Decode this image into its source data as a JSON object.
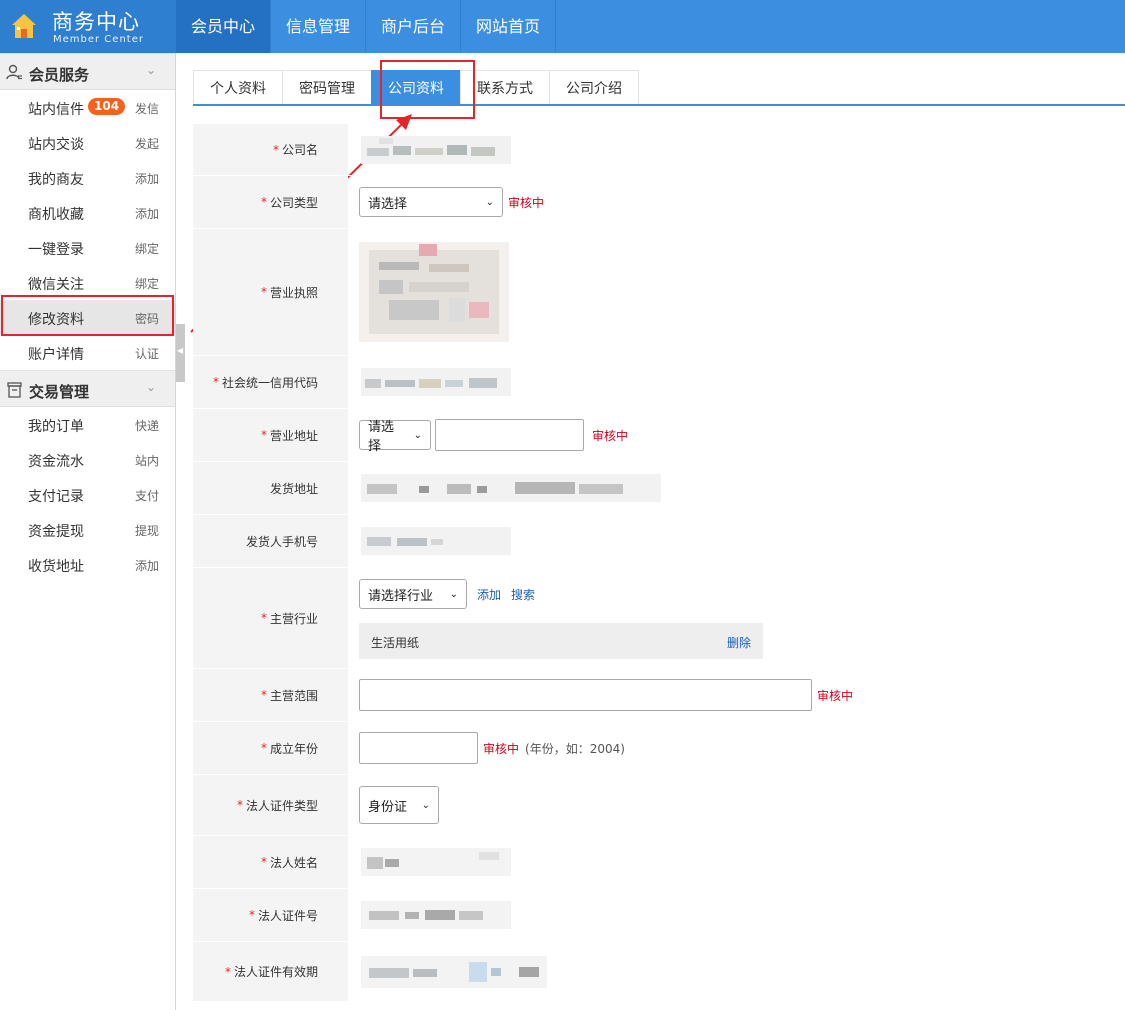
{
  "header": {
    "logo_cn": "商务中心",
    "logo_en": "Member Center",
    "nav": [
      "会员中心",
      "信息管理",
      "商户后台",
      "网站首页"
    ],
    "nav_active": 0
  },
  "sidebar": {
    "sections": [
      {
        "title": "会员服务",
        "items": [
          {
            "label": "站内信件",
            "action": "发信",
            "badge": "104"
          },
          {
            "label": "站内交谈",
            "action": "发起"
          },
          {
            "label": "我的商友",
            "action": "添加"
          },
          {
            "label": "商机收藏",
            "action": "添加"
          },
          {
            "label": "一键登录",
            "action": "绑定"
          },
          {
            "label": "微信关注",
            "action": "绑定"
          },
          {
            "label": "修改资料",
            "action": "密码",
            "active": true
          },
          {
            "label": "账户详情",
            "action": "认证"
          }
        ]
      },
      {
        "title": "交易管理",
        "items": [
          {
            "label": "我的订单",
            "action": "快递"
          },
          {
            "label": "资金流水",
            "action": "站内"
          },
          {
            "label": "支付记录",
            "action": "支付"
          },
          {
            "label": "资金提现",
            "action": "提现"
          },
          {
            "label": "收货地址",
            "action": "添加"
          }
        ]
      }
    ]
  },
  "tabs": [
    "个人资料",
    "密码管理",
    "公司资料",
    "联系方式",
    "公司介绍"
  ],
  "tabs_active": 2,
  "form": {
    "company_name": {
      "label": "公司名",
      "required": true
    },
    "company_type": {
      "label": "公司类型",
      "required": true,
      "selected": "请选择",
      "status": "审核中"
    },
    "license": {
      "label": "营业执照",
      "required": true
    },
    "credit_code": {
      "label": "社会统一信用代码",
      "required": true
    },
    "biz_address": {
      "label": "营业地址",
      "required": true,
      "selected": "请选择",
      "status": "审核中"
    },
    "ship_address": {
      "label": "发货地址",
      "required": false
    },
    "shipper_phone": {
      "label": "发货人手机号",
      "required": false
    },
    "industry": {
      "label": "主营行业",
      "required": true,
      "selected": "请选择行业",
      "add": "添加",
      "search": "搜索",
      "item": "生活用纸",
      "delete": "删除"
    },
    "scope": {
      "label": "主营范围",
      "required": true,
      "status": "审核中"
    },
    "founded": {
      "label": "成立年份",
      "required": true,
      "status": "审核中",
      "hint": "(年份，如：2004)"
    },
    "id_type": {
      "label": "法人证件类型",
      "required": true,
      "selected": "身份证"
    },
    "legal_name": {
      "label": "法人姓名",
      "required": true
    },
    "id_number": {
      "label": "法人证件号",
      "required": true
    },
    "id_validity": {
      "label": "法人证件有效期",
      "required": true
    }
  },
  "colors": {
    "brand": "#3c8fe0",
    "highlight": "#e3262b",
    "badge": "#f7611d"
  }
}
